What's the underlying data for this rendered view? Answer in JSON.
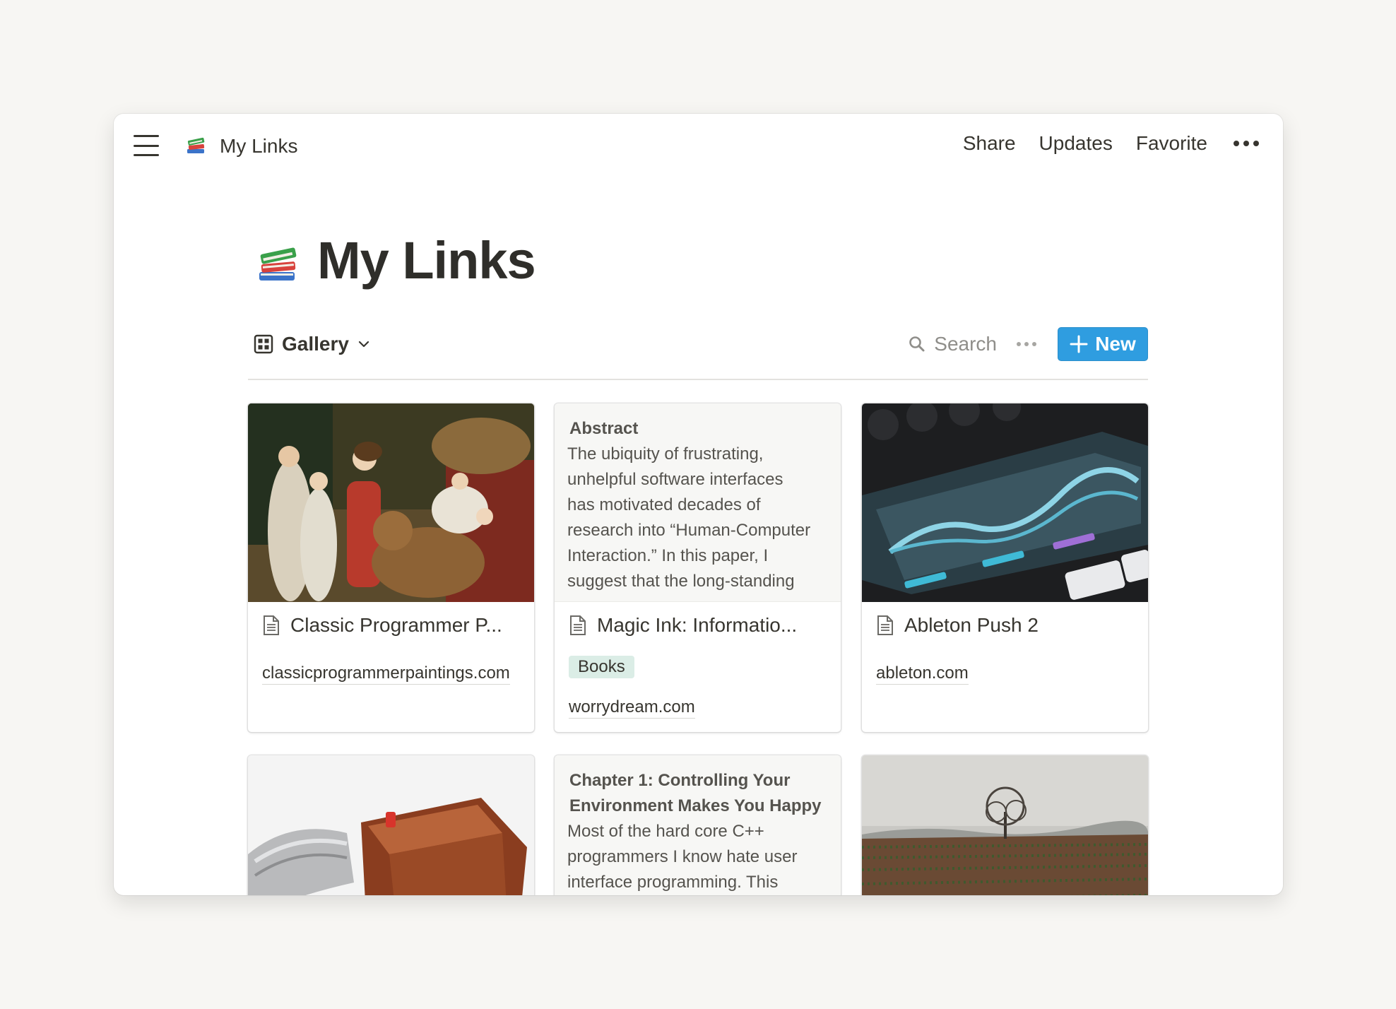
{
  "topbar": {
    "breadcrumb_title": "My Links",
    "actions": {
      "share": "Share",
      "updates": "Updates",
      "favorite": "Favorite"
    }
  },
  "page": {
    "title": "My Links",
    "icon": "books-icon"
  },
  "view": {
    "name": "Gallery",
    "search_label": "Search",
    "new_label": "New",
    "accent_color": "#2f9de0"
  },
  "cards": [
    {
      "title": "Classic Programmer P...",
      "link": "classicprogrammerpaintings.com",
      "cover": "painting-image"
    },
    {
      "cover_head": "Abstract",
      "cover_lines": [
        "The ubiquity of frustrating,",
        "unhelpful software interfaces",
        "has motivated decades of",
        "research into “Human-Computer",
        "Interaction.” In this paper, I",
        "suggest that the long-standing"
      ],
      "title": "Magic Ink: Informatio...",
      "tag": "Books",
      "tag_color": "#dbede6",
      "link": "worrydream.com"
    },
    {
      "title": "Ableton Push 2",
      "link": "ableton.com",
      "cover": "device-screen-image"
    },
    {
      "cover": "mouse-image"
    },
    {
      "cover_head_lines": [
        "Chapter 1: Controlling Your",
        "Environment Makes You Happy"
      ],
      "cover_lines": [
        "Most of the hard core C++",
        "programmers I know hate user",
        "interface programming. This"
      ]
    },
    {
      "cover": "landscape-image"
    }
  ]
}
